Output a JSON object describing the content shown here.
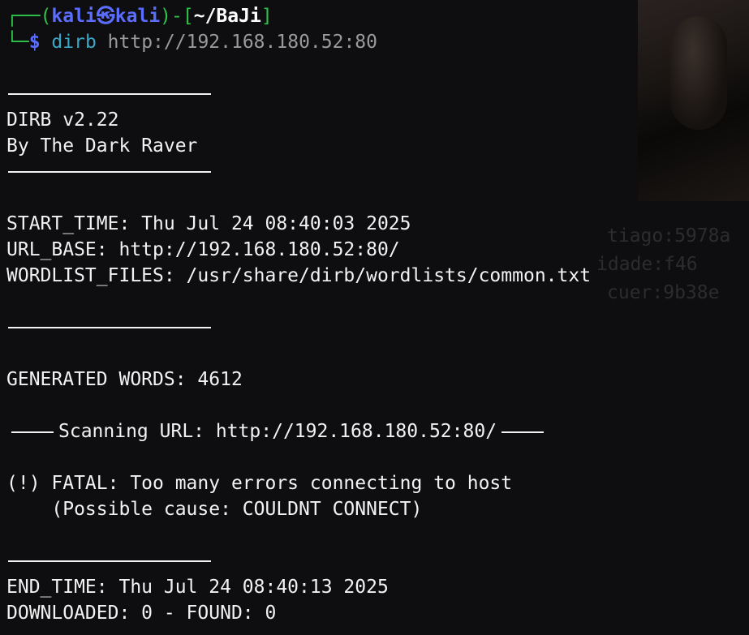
{
  "prompt": {
    "user": "kali",
    "symbol": "㉿",
    "host": "kali",
    "path": "~/BaJi",
    "dollar": "$",
    "command": "dirb",
    "argument": "http://192.168.180.52:80"
  },
  "background_ghost": [
    "tiago:5978a",
    "idade:f46",
    "cuer:9b38e"
  ],
  "output": {
    "version": "DIRB v2.22",
    "author": "By The Dark Raver",
    "start_time": "START_TIME: Thu Jul 24 08:40:03 2025",
    "url_base": "URL_BASE: http://192.168.180.52:80/",
    "wordlist": "WORDLIST_FILES: /usr/share/dirb/wordlists/common.txt",
    "generated": "GENERATED WORDS: 4612",
    "scanning": "Scanning URL: http://192.168.180.52:80/",
    "fatal": "(!) FATAL: Too many errors connecting to host",
    "cause": "    (Possible cause: COULDNT CONNECT)",
    "end_time": "END_TIME: Thu Jul 24 08:40:13 2025",
    "downloaded": "DOWNLOADED: 0 - FOUND: 0"
  },
  "colors": {
    "background": "#0e0e10",
    "prompt_green": "#2fc24b",
    "prompt_blue": "#5b6dff",
    "command_cyan": "#3aa7c9",
    "text": "#f2f2f2"
  }
}
